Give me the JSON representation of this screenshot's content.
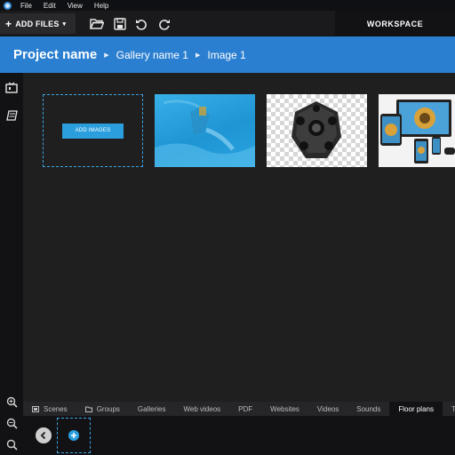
{
  "menubar": {
    "items": [
      "File",
      "Edit",
      "View",
      "Help"
    ]
  },
  "toolbar": {
    "add_files_label": "ADD FILES",
    "workspace_label": "WORKSPACE",
    "icons": [
      "open-folder-icon",
      "save-icon",
      "undo-icon",
      "redo-icon"
    ]
  },
  "breadcrumb": {
    "project": "Project name",
    "gallery": "Gallery name 1",
    "image": "Image 1"
  },
  "gallery": {
    "add_images_label": "ADD IMAGES",
    "thumbnails": [
      "underwater-photo",
      "360-camera-rig",
      "devices-mockup"
    ]
  },
  "tabs": [
    "Scenes",
    "Groups",
    "Galleries",
    "Web videos",
    "PDF",
    "Websites",
    "Videos",
    "Sounds",
    "Floor plans",
    "Tim"
  ],
  "active_tab": "Floor plans",
  "colors": {
    "accent": "#2b7fd0",
    "button_blue": "#2b9fde",
    "dashed_border": "#3ba3e2",
    "background": "#1e1e1e"
  }
}
